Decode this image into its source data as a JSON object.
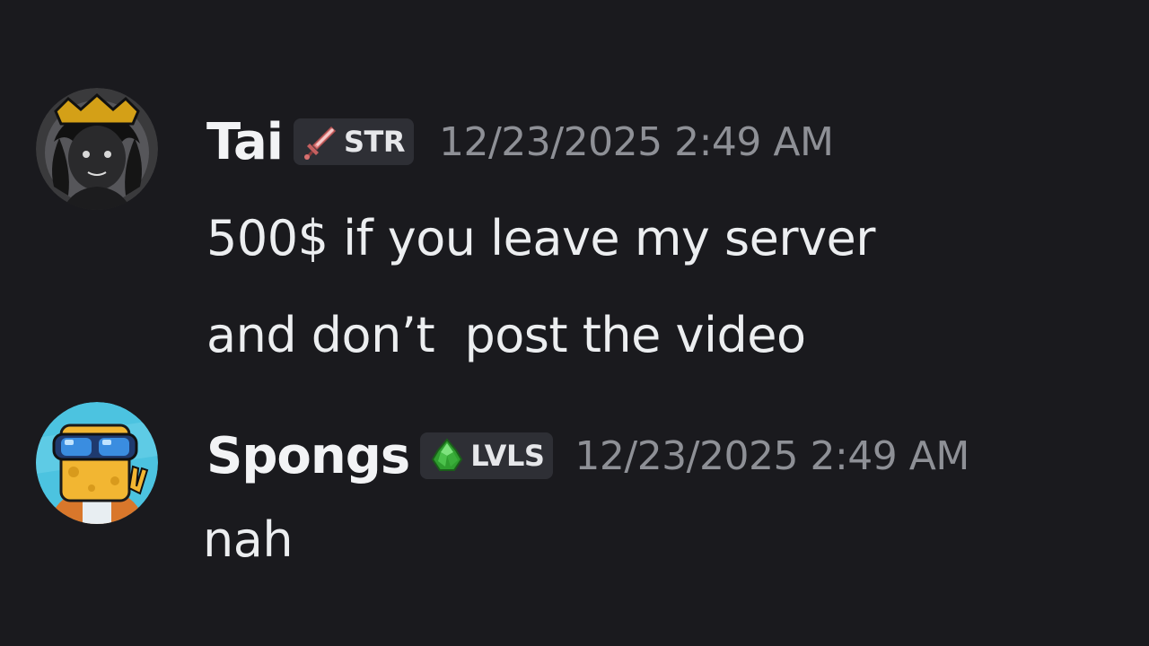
{
  "messages": [
    {
      "username": "Tai",
      "tag": {
        "label": "STR",
        "icon": "sword-icon",
        "color": "#e88a8a"
      },
      "timestamp": "12/23/2025 2:49 AM",
      "lines": [
        "500$ if you leave my server",
        "and don’t  post the video"
      ],
      "avatar": {
        "icon": "crowned-character-avatar",
        "accent": "#d4a017"
      }
    },
    {
      "username": "Spongs",
      "tag": {
        "label": "LVLS",
        "icon": "green-gem-icon",
        "color": "#3fbf3f"
      },
      "timestamp": "12/23/2025 2:49 AM",
      "lines": [
        "nah"
      ],
      "avatar": {
        "icon": "sponge-goggles-avatar",
        "accent": "#4cc3e0"
      }
    }
  ],
  "colors": {
    "background": "#1a1a1e",
    "username": "#f2f3f5",
    "timestamp": "#8e9096",
    "message": "#eceef0",
    "tag_background": "#2e2f35"
  }
}
